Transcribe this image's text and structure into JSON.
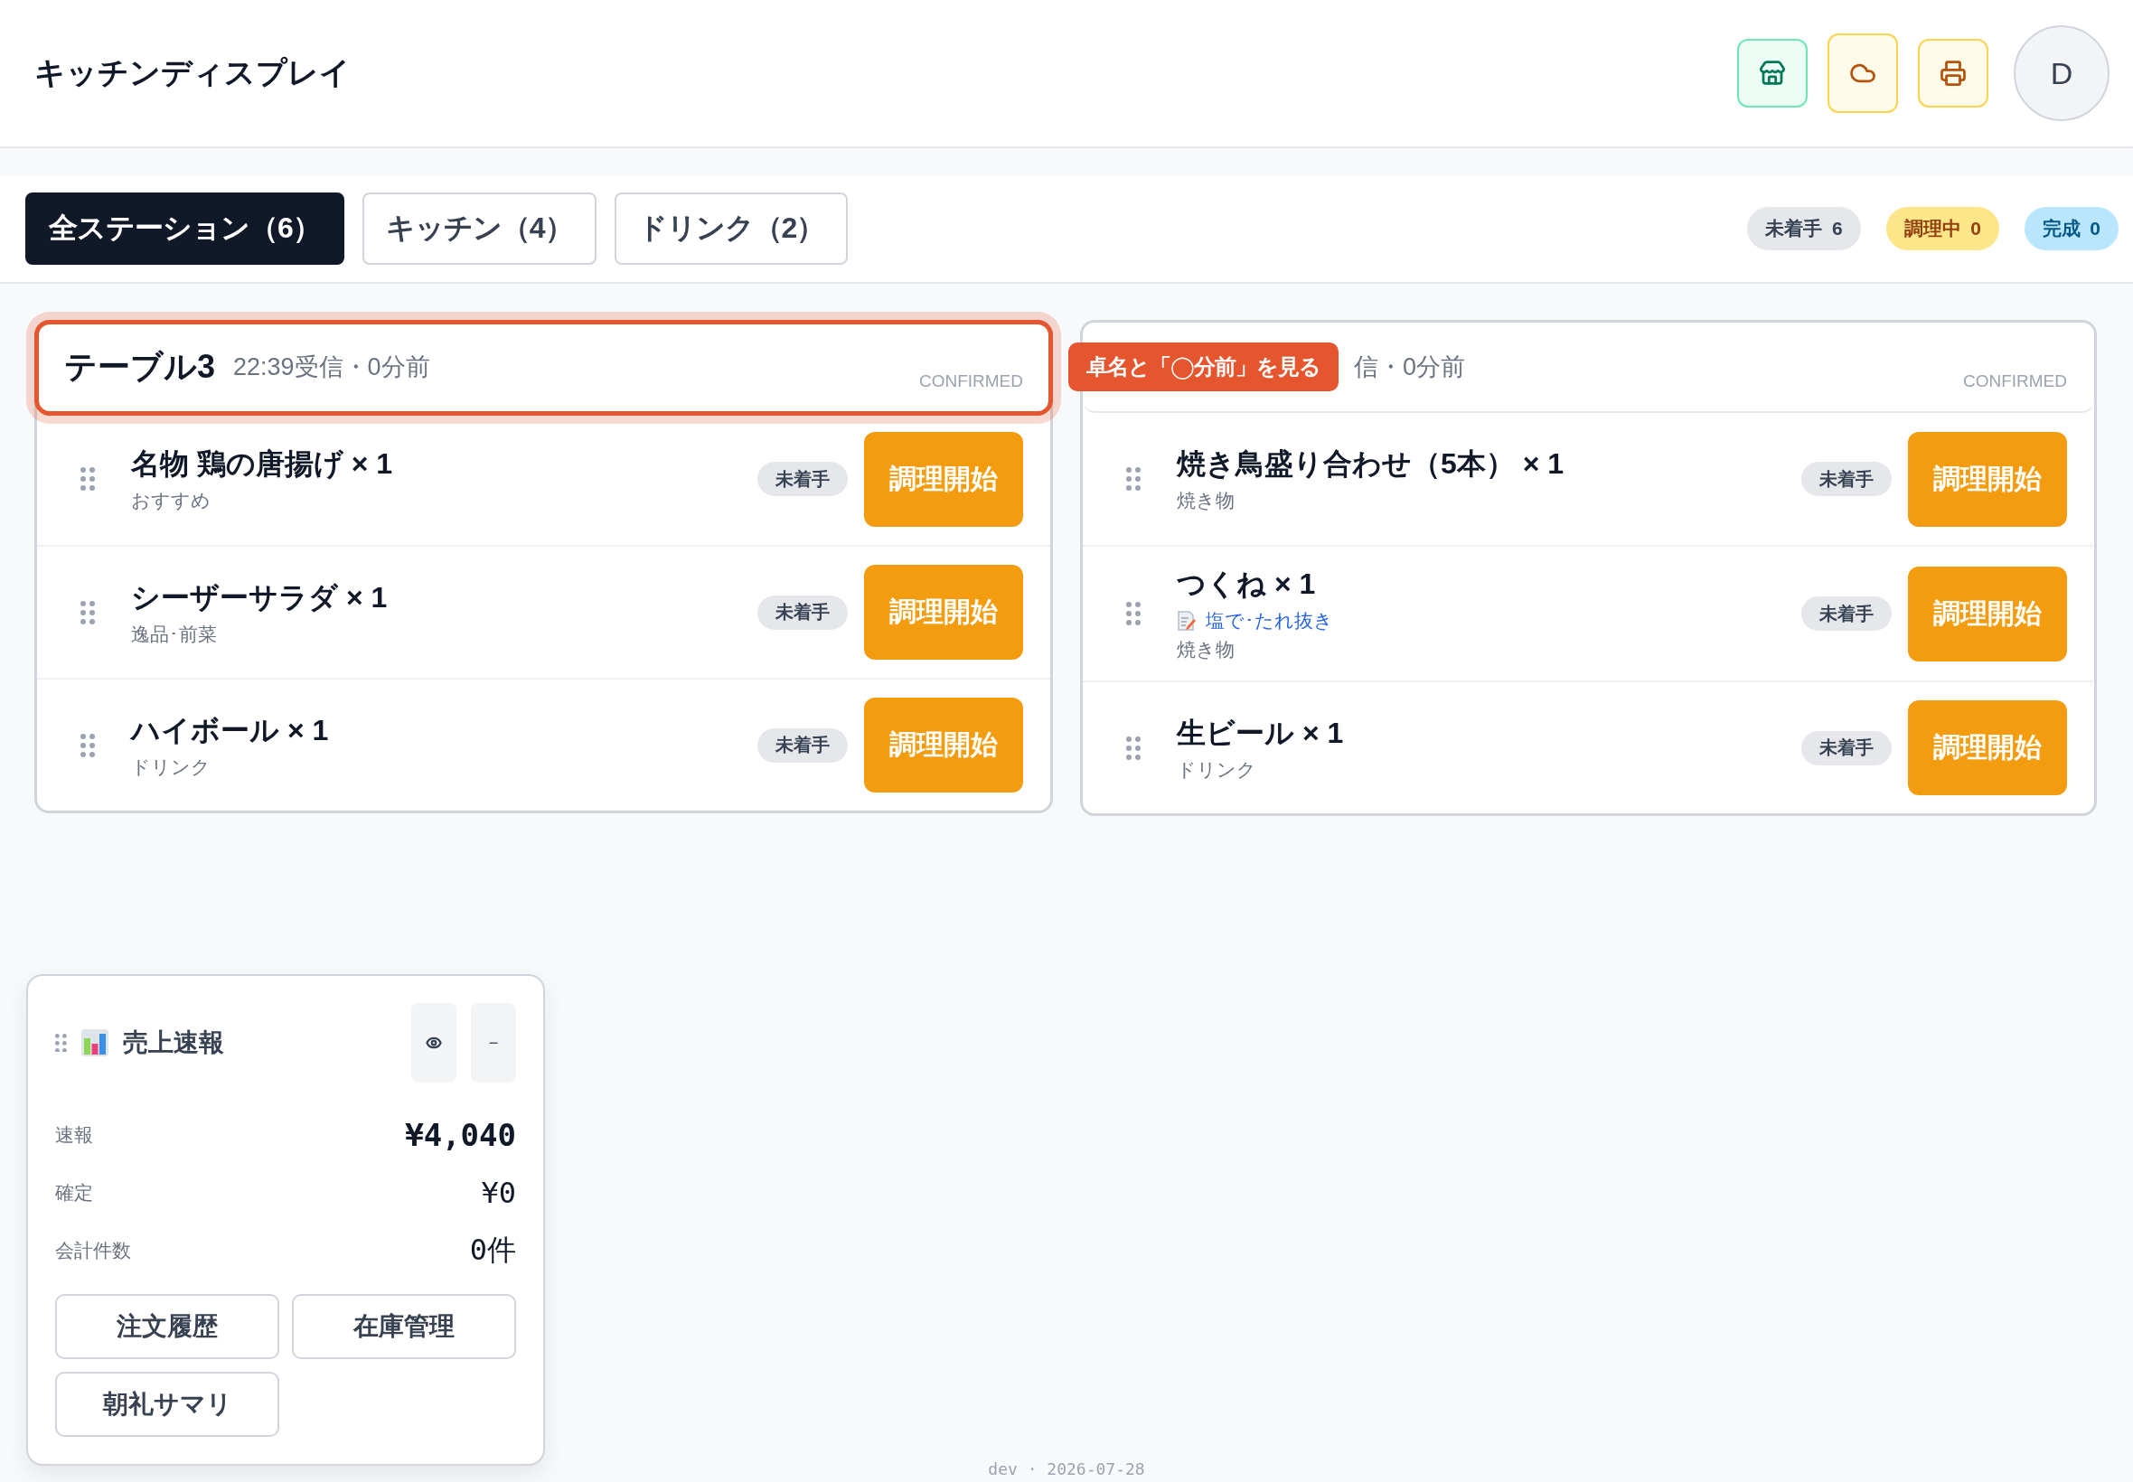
{
  "header": {
    "title": "キッチンディスプレイ",
    "actions": [
      {
        "kind": "store"
      },
      {
        "kind": "cloud"
      },
      {
        "kind": "printer"
      }
    ],
    "avatar": "D"
  },
  "tabs": [
    {
      "label": "全ステーション（6）",
      "selected": true
    },
    {
      "label": "キッチン（4）",
      "selected": false
    },
    {
      "label": "ドリンク（2）",
      "selected": false
    }
  ],
  "status_counts": [
    {
      "kind": "pending",
      "label": "未着手",
      "count": "6"
    },
    {
      "kind": "cooking",
      "label": "調理中",
      "count": "0"
    },
    {
      "kind": "done",
      "label": "完成",
      "count": "0"
    }
  ],
  "orders": [
    {
      "title": "テーブル3",
      "meta": "22:39受信・0分前",
      "status": "CONFIRMED",
      "highlighted": true,
      "items": [
        {
          "name": "名物 鶏の唐揚げ × 1",
          "category": "おすすめ",
          "state": "未着手",
          "action": "調理開始"
        },
        {
          "name": "シーザーサラダ × 1",
          "category": "逸品･前菜",
          "state": "未着手",
          "action": "調理開始"
        },
        {
          "name": "ハイボール × 1",
          "category": "ドリンク",
          "state": "未着手",
          "action": "調理開始"
        }
      ]
    },
    {
      "meta": "信・0分前",
      "status": "CONFIRMED",
      "highlighted": false,
      "items": [
        {
          "name": "焼き鳥盛り合わせ（5本） × 1",
          "category": "焼き物",
          "state": "未着手",
          "action": "調理開始"
        },
        {
          "name": "つくね × 1",
          "note": "塩で･たれ抜き",
          "category": "焼き物",
          "state": "未着手",
          "action": "調理開始"
        },
        {
          "name": "生ビール × 1",
          "category": "ドリンク",
          "state": "未着手",
          "action": "調理開始"
        }
      ]
    }
  ],
  "tutorial_tip": {
    "text": "卓名と「◯分前」を見る"
  },
  "sales_widget": {
    "title": "売上速報",
    "minimize": "−",
    "rows": [
      {
        "label": "速報",
        "value": "¥4,040",
        "strong": true
      },
      {
        "label": "確定",
        "value": "¥0",
        "strong": false
      },
      {
        "label": "会計件数",
        "value": "0件",
        "strong": false
      }
    ],
    "buttons": [
      "注文履歴",
      "在庫管理",
      "朝礼サマリ"
    ]
  },
  "footer": "dev · 2026-07-28"
}
